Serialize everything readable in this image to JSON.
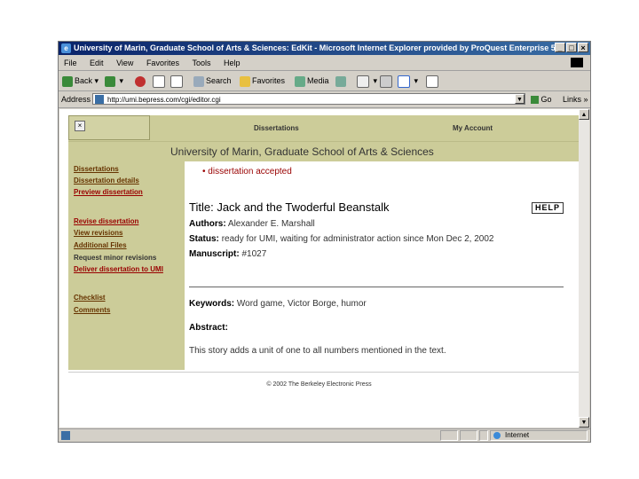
{
  "window": {
    "title": "University of Marin, Graduate School of Arts & Sciences: EdKit - Microsoft Internet Explorer provided by ProQuest Enterprise 5",
    "controls": [
      "_",
      "□",
      "×"
    ]
  },
  "menu": [
    "File",
    "Edit",
    "View",
    "Favorites",
    "Tools",
    "Help"
  ],
  "toolbar": {
    "back": "Back",
    "search": "Search",
    "favorites": "Favorites",
    "media": "Media"
  },
  "address": {
    "label": "Address",
    "url": "http://umi.bepress.com/cgi/editor.cgi",
    "go": "Go",
    "links": "Links"
  },
  "page": {
    "nav": {
      "dissertations": "Dissertations",
      "my_account": "My Account"
    },
    "banner": "University of Marin, Graduate School of Arts & Sciences",
    "sidebar": [
      {
        "label": "Dissertations"
      },
      {
        "label": "Dissertation details"
      },
      {
        "label": "Preview dissertation"
      },
      {
        "label": "Revise dissertation"
      },
      {
        "label": "View revisions"
      },
      {
        "label": "Additional Files"
      },
      {
        "label": "Request minor revisions"
      },
      {
        "label": "Deliver dissertation to UMI"
      },
      {
        "label": "Checklist"
      },
      {
        "label": "Comments"
      }
    ],
    "status_message": "dissertation accepted",
    "title_label": "Title:",
    "title": "Jack and the Twoderful Beanstalk",
    "help": "HELP",
    "authors_label": "Authors:",
    "authors": "Alexander E. Marshall",
    "status_label": "Status:",
    "status": "ready for UMI, waiting for administrator action since Mon Dec 2, 2002",
    "manuscript_label": "Manuscript:",
    "manuscript": "#1027",
    "keywords_label": "Keywords:",
    "keywords": "Word game, Victor Borge, humor",
    "abstract_label": "Abstract:",
    "abstract": "This story adds a unit of one to all numbers mentioned in the text.",
    "footer": "© 2002 The Berkeley Electronic Press"
  },
  "status": {
    "zone": "Internet"
  },
  "colors": {
    "page_accent": "#cccc99",
    "link": "#663300",
    "alert": "#990000"
  }
}
